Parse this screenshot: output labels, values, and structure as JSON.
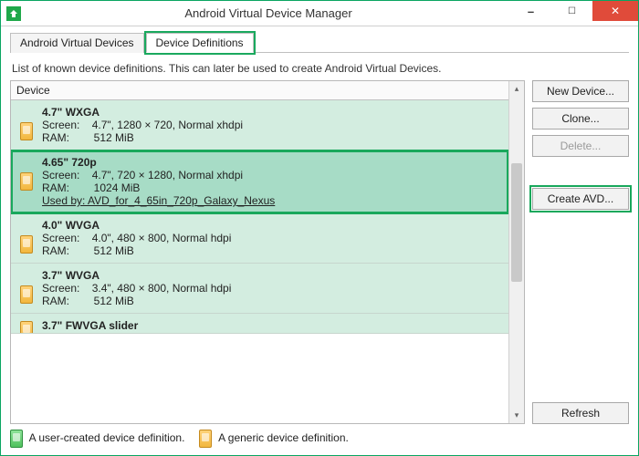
{
  "window": {
    "title": "Android Virtual Device Manager"
  },
  "tabs": {
    "avds": "Android Virtual Devices",
    "defs": "Device Definitions"
  },
  "description": "List of known device definitions. This can later be used to create Android Virtual Devices.",
  "columnHeader": "Device",
  "rows": [
    {
      "title": "4.7\" WXGA",
      "screen": "Screen:    4.7\", 1280 × 720, Normal xhdpi",
      "ram": "RAM:        512 MiB",
      "usedby": ""
    },
    {
      "title": "4.65\" 720p",
      "screen": "Screen:    4.7\", 720 × 1280, Normal xhdpi",
      "ram": "RAM:        1024 MiB",
      "usedby": "Used by: AVD_for_4_65in_720p_Galaxy_Nexus"
    },
    {
      "title": "4.0\" WVGA",
      "screen": "Screen:    4.0\", 480 × 800, Normal hdpi",
      "ram": "RAM:        512 MiB",
      "usedby": ""
    },
    {
      "title": "3.7\" WVGA",
      "screen": "Screen:    3.4\", 480 × 800, Normal hdpi",
      "ram": "RAM:        512 MiB",
      "usedby": ""
    },
    {
      "title": "3.7\" FWVGA slider",
      "screen": "",
      "ram": "",
      "usedby": ""
    }
  ],
  "buttons": {
    "newDevice": "New Device...",
    "clone": "Clone...",
    "delete": "Delete...",
    "createAvd": "Create AVD...",
    "refresh": "Refresh"
  },
  "legend": {
    "user": "A user-created device definition.",
    "generic": "A generic device definition."
  }
}
